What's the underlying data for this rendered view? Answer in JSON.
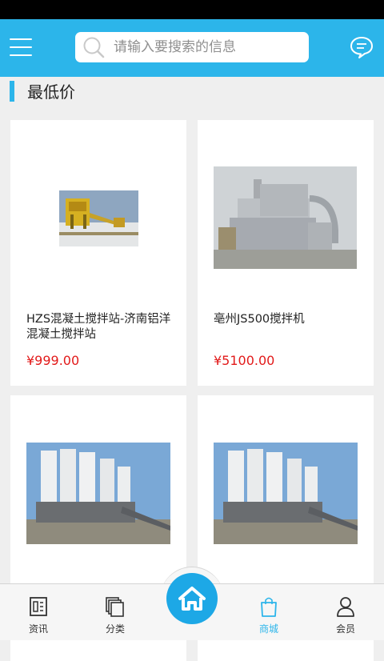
{
  "header": {
    "search_placeholder": "请输入要搜索的信息"
  },
  "section": {
    "title": "最低价"
  },
  "products": [
    {
      "name": "HZS混凝土搅拌站-济南铝洋混凝土搅拌站",
      "price": "¥999.00"
    },
    {
      "name": "亳州JS500搅拌机",
      "price": "¥5100.00"
    },
    {
      "name": "",
      "price": ""
    },
    {
      "name": "",
      "price": ""
    }
  ],
  "tabbar": {
    "tabs": [
      {
        "label": "资讯",
        "icon": "news-icon"
      },
      {
        "label": "分类",
        "icon": "category-icon"
      },
      {
        "label": "",
        "icon": "home-icon"
      },
      {
        "label": "商城",
        "icon": "shopping-bag-icon",
        "active": true
      },
      {
        "label": "会员",
        "icon": "member-icon"
      }
    ]
  },
  "colors": {
    "accent": "#2cb5ea",
    "price": "#e21a1a"
  }
}
